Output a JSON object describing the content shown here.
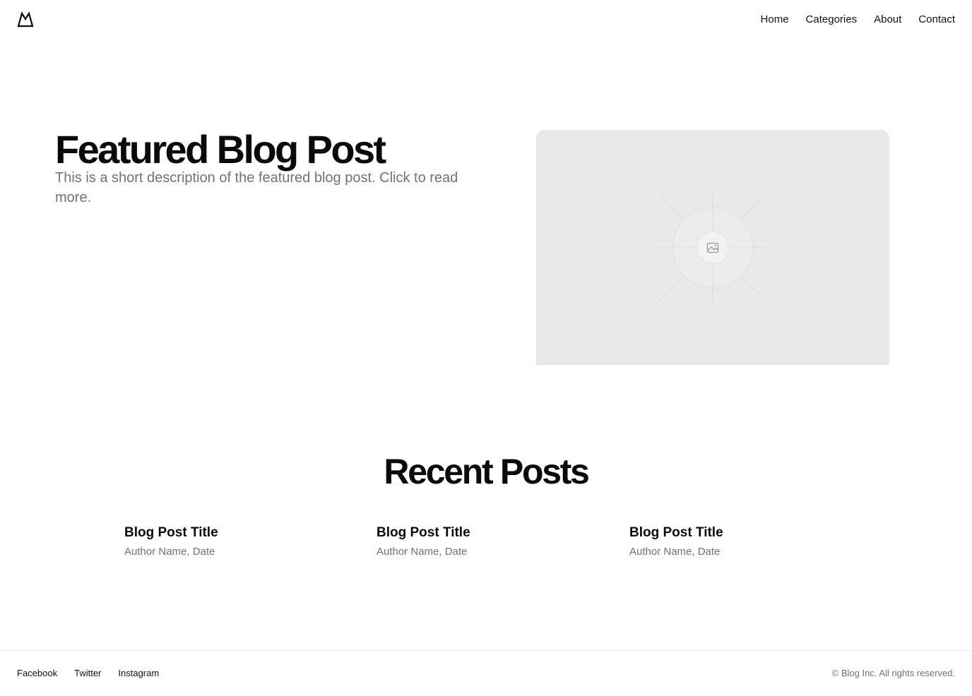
{
  "header": {
    "logo_icon": "mountain-logo-icon",
    "nav": [
      {
        "label": "Home"
      },
      {
        "label": "Categories"
      },
      {
        "label": "About"
      },
      {
        "label": "Contact"
      }
    ]
  },
  "hero": {
    "title": "Featured Blog Post",
    "description": "This is a short description of the featured blog post. Click to read more.",
    "image_icon": "image-placeholder-icon"
  },
  "recent": {
    "heading": "Recent Posts",
    "posts": [
      {
        "title": "Blog Post Title",
        "meta": "Author Name, Date"
      },
      {
        "title": "Blog Post Title",
        "meta": "Author Name, Date"
      },
      {
        "title": "Blog Post Title",
        "meta": "Author Name, Date"
      }
    ]
  },
  "footer": {
    "links": [
      {
        "label": "Facebook"
      },
      {
        "label": "Twitter"
      },
      {
        "label": "Instagram"
      }
    ],
    "copyright": "© Blog Inc. All rights reserved."
  },
  "colors": {
    "text": "#0a0a0a",
    "muted": "#6b7280",
    "placeholder_bg": "#e9e9e9",
    "border": "#e5e7eb"
  }
}
